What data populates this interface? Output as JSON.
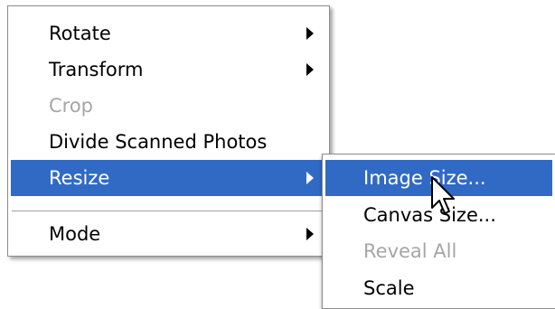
{
  "main_menu": {
    "items": [
      {
        "label": "Rotate",
        "has_submenu": true
      },
      {
        "label": "Transform",
        "has_submenu": true
      },
      {
        "label": "Crop",
        "disabled": true
      },
      {
        "label": "Divide Scanned Photos"
      },
      {
        "label": "Resize",
        "has_submenu": true,
        "highlighted": true
      },
      {
        "label": "Mode",
        "has_submenu": true
      }
    ]
  },
  "submenu": {
    "items": [
      {
        "label": "Image Size...",
        "highlighted": true
      },
      {
        "label": "Canvas Size..."
      },
      {
        "label": "Reveal All",
        "disabled": true
      },
      {
        "label": "Scale"
      }
    ]
  },
  "colors": {
    "highlight_bg": "#316ac5",
    "highlight_text": "#ffffff",
    "disabled_text": "#a6a6a6"
  },
  "cursor": {
    "icon": "arrow-pointer-icon"
  }
}
